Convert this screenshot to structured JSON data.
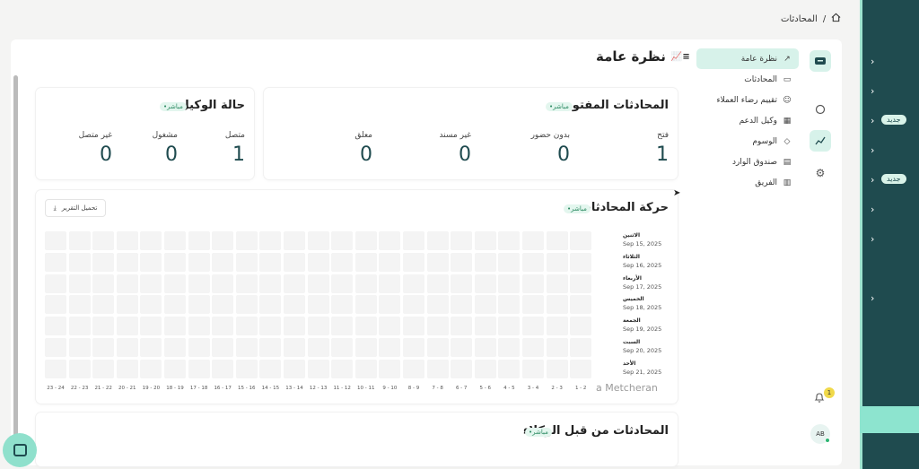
{
  "breadcrumb": {
    "separator": "/",
    "current": "المحادثات"
  },
  "page": {
    "title": "نظرة عامة"
  },
  "nav": {
    "items": [
      {
        "label": "نظرة عامة",
        "icon": "chart-icon"
      },
      {
        "label": "المحادثات",
        "icon": "chat-icon"
      },
      {
        "label": "تقييم رضاء العملاء",
        "icon": "smile-icon"
      },
      {
        "label": "وكيل الدعم",
        "icon": "agent-icon"
      },
      {
        "label": "الوسوم",
        "icon": "tag-icon"
      },
      {
        "label": "صندوق الوارد",
        "icon": "inbox-icon"
      },
      {
        "label": "الفريق",
        "icon": "team-icon"
      }
    ]
  },
  "open_conversations": {
    "title": "المحادثات المفتوحة",
    "live": "•مباشر",
    "stats": [
      {
        "label": "فتح",
        "value": "1"
      },
      {
        "label": "بدون حضور",
        "value": "0"
      },
      {
        "label": "غير مسند",
        "value": "0"
      },
      {
        "label": "معلق",
        "value": "0"
      }
    ]
  },
  "agent_status": {
    "title": "حالة الوكيل",
    "live": "•مباشر",
    "stats": [
      {
        "label": "متصل",
        "value": "1"
      },
      {
        "label": "مشغول",
        "value": "0"
      },
      {
        "label": "غير متصل",
        "value": "0"
      }
    ]
  },
  "traffic": {
    "title": "حركة المحادثات",
    "live": "•مباشر",
    "download_label": "تحميل التقرير",
    "days": [
      {
        "day": "الاثنين",
        "date": "Sep 15, 2025"
      },
      {
        "day": "الثلاثاء",
        "date": "Sep 16, 2025"
      },
      {
        "day": "الأربعاء",
        "date": "Sep 17, 2025"
      },
      {
        "day": "الخميس",
        "date": "Sep 18, 2025"
      },
      {
        "day": "الجمعة",
        "date": "Sep 19, 2025"
      },
      {
        "day": "السبت",
        "date": "Sep 20, 2025"
      },
      {
        "day": "الأحد",
        "date": "Sep 21, 2025"
      }
    ],
    "hours": [
      "1 - 2",
      "2 - 3",
      "3 - 4",
      "4 - 5",
      "5 - 6",
      "6 - 7",
      "7 - 8",
      "8 - 9",
      "9 - 10",
      "10 - 11",
      "11 - 12",
      "12 - 13",
      "13 - 14",
      "14 - 15",
      "15 - 16",
      "16 - 17",
      "17 - 18",
      "18 - 19",
      "19 - 20",
      "20 - 21",
      "21 - 22",
      "22 - 23",
      "23 - 24"
    ]
  },
  "agent_conversations": {
    "title": "المحادثات من قبل الوكلاء",
    "live": "•مباشر"
  },
  "watermark": "a Metcheran",
  "sidebar_right": {
    "new_badge": "جديد"
  },
  "notifications": {
    "count": "1"
  },
  "user": {
    "initials": "AB"
  },
  "colors": {
    "accent": "#1f4b4f",
    "mint": "#8de4cf",
    "active_nav": "#d7f2ea"
  }
}
